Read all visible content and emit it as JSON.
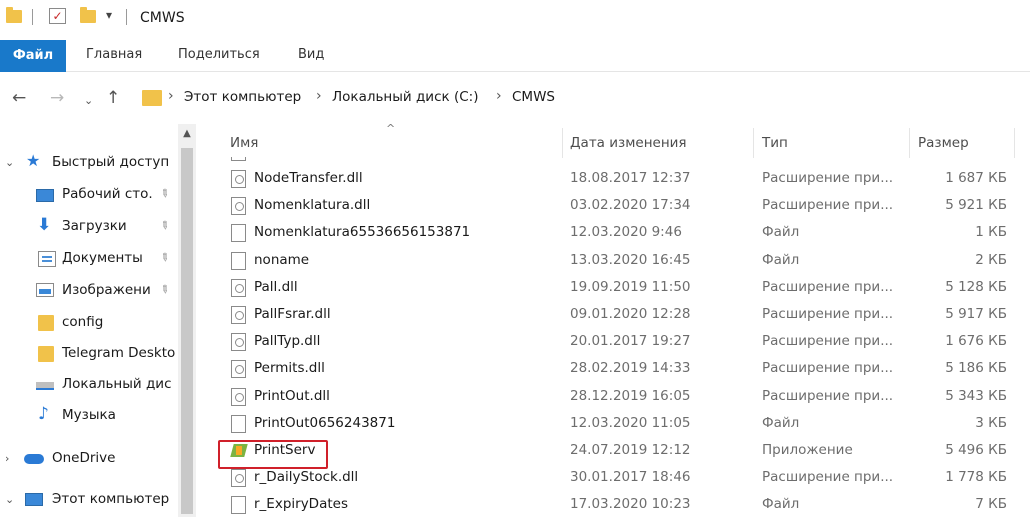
{
  "window": {
    "title": "CMWS"
  },
  "ribbon": {
    "tabs": [
      "Файл",
      "Главная",
      "Поделиться",
      "Вид"
    ]
  },
  "address": {
    "crumbs": [
      "Этот компьютер",
      "Локальный диск (C:)",
      "CMWS"
    ]
  },
  "sidebar": {
    "items": [
      {
        "label": "Быстрый доступ",
        "icon": "star-icon",
        "pinned": false
      },
      {
        "label": "Рабочий сто.",
        "icon": "desktop-icon",
        "pinned": true
      },
      {
        "label": "Загрузки",
        "icon": "download-icon",
        "pinned": true
      },
      {
        "label": "Документы",
        "icon": "documents-icon",
        "pinned": true
      },
      {
        "label": "Изображени",
        "icon": "images-icon",
        "pinned": true
      },
      {
        "label": "config",
        "icon": "folder-icon",
        "pinned": false
      },
      {
        "label": "Telegram Deskto",
        "icon": "folder-icon",
        "pinned": false
      },
      {
        "label": "Локальный дис",
        "icon": "drive-icon",
        "pinned": false
      },
      {
        "label": "Музыка",
        "icon": "music-icon",
        "pinned": false
      },
      {
        "label": "OneDrive",
        "icon": "cloud-icon",
        "pinned": false
      },
      {
        "label": "Этот компьютер",
        "icon": "computer-icon",
        "pinned": false
      }
    ]
  },
  "columns": {
    "name": "Имя",
    "date": "Дата изменения",
    "type": "Тип",
    "size": "Размер"
  },
  "files": [
    {
      "name": "NodeTransfer.dll",
      "date": "18.08.2017 12:37",
      "type": "Расширение при...",
      "size": "1 687 КБ",
      "kind": "dll"
    },
    {
      "name": "Nomenklatura.dll",
      "date": "03.02.2020 17:34",
      "type": "Расширение при...",
      "size": "5 921 КБ",
      "kind": "dll"
    },
    {
      "name": "Nomenklatura65536656153871",
      "date": "12.03.2020 9:46",
      "type": "Файл",
      "size": "1 КБ",
      "kind": "file"
    },
    {
      "name": "noname",
      "date": "13.03.2020 16:45",
      "type": "Файл",
      "size": "2 КБ",
      "kind": "file"
    },
    {
      "name": "Pall.dll",
      "date": "19.09.2019 11:50",
      "type": "Расширение при...",
      "size": "5 128 КБ",
      "kind": "dll"
    },
    {
      "name": "PallFsrar.dll",
      "date": "09.01.2020 12:28",
      "type": "Расширение при...",
      "size": "5 917 КБ",
      "kind": "dll"
    },
    {
      "name": "PallTyp.dll",
      "date": "20.01.2017 19:27",
      "type": "Расширение при...",
      "size": "1 676 КБ",
      "kind": "dll"
    },
    {
      "name": "Permits.dll",
      "date": "28.02.2019 14:33",
      "type": "Расширение при...",
      "size": "5 186 КБ",
      "kind": "dll"
    },
    {
      "name": "PrintOut.dll",
      "date": "28.12.2019 16:05",
      "type": "Расширение при...",
      "size": "5 343 КБ",
      "kind": "dll"
    },
    {
      "name": "PrintOut0656243871",
      "date": "12.03.2020 11:05",
      "type": "Файл",
      "size": "3 КБ",
      "kind": "file"
    },
    {
      "name": "PrintServ",
      "date": "24.07.2019 12:12",
      "type": "Приложение",
      "size": "5 496 КБ",
      "kind": "app"
    },
    {
      "name": "r_DailyStock.dll",
      "date": "30.01.2017 18:46",
      "type": "Расширение при...",
      "size": "1 778 КБ",
      "kind": "dll"
    },
    {
      "name": "r_ExpiryDates",
      "date": "17.03.2020 10:23",
      "type": "Файл",
      "size": "7 КБ",
      "kind": "file"
    }
  ],
  "highlight_color": "#d0202a"
}
